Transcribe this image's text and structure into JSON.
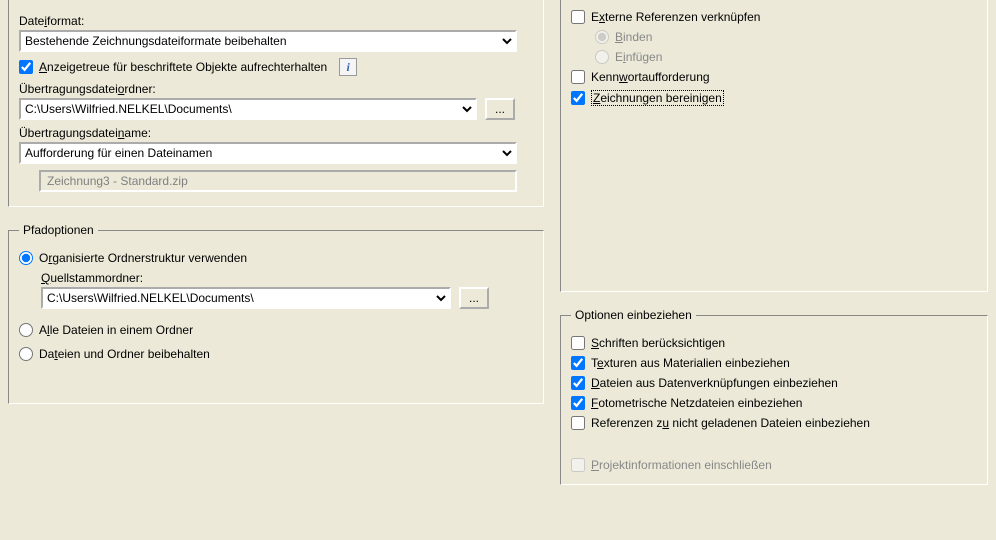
{
  "left_top": {
    "file_format_label_pre": "Date",
    "file_format_label_mn": "i",
    "file_format_label_post": "format:",
    "file_format_value": "Bestehende Zeichnungsdateiformate beibehalten",
    "visual_fidelity_pre": "",
    "visual_fidelity_mn": "A",
    "visual_fidelity_post": "nzeigetreue für beschriftete Objekte aufrechterhalten",
    "transfer_folder_label_pre": "Übertragungsdatei",
    "transfer_folder_label_mn": "o",
    "transfer_folder_label_post": "rdner:",
    "transfer_folder_value": "C:\\Users\\Wilfried.NELKEL\\Documents\\",
    "browse": "...",
    "transfer_name_label_pre": "Übertragungsdatei",
    "transfer_name_label_mn": "n",
    "transfer_name_label_post": "ame:",
    "transfer_name_value": "Aufforderung für einen Dateinamen",
    "filename_preview": "Zeichnung3 - Standard.zip"
  },
  "path_options": {
    "legend": "Pfadoptionen",
    "opt_org_pre": "O",
    "opt_org_mn": "r",
    "opt_org_post": "ganisierte Ordnerstruktur verwenden",
    "source_root_pre": "",
    "source_root_mn": "Q",
    "source_root_post": "uellstammordner:",
    "source_root_value": "C:\\Users\\Wilfried.NELKEL\\Documents\\",
    "browse": "...",
    "opt_all_pre": "A",
    "opt_all_mn": "l",
    "opt_all_post": "le Dateien in einem Ordner",
    "opt_keep_pre": "Da",
    "opt_keep_mn": "t",
    "opt_keep_post": "eien und Ordner beibehalten"
  },
  "right_top": {
    "ext_refs_pre": "E",
    "ext_refs_mn": "x",
    "ext_refs_post": "terne Referenzen verknüpfen",
    "bind_pre": "",
    "bind_mn": "B",
    "bind_post": "inden",
    "insert_pre": "E",
    "insert_mn": "i",
    "insert_post": "nfügen",
    "pwd_pre": "Kenn",
    "pwd_mn": "w",
    "pwd_post": "ortaufforderung",
    "purge_pre": "",
    "purge_mn": "Z",
    "purge_post": "eichnungen bereinigen"
  },
  "include_options": {
    "legend": "Optionen einbeziehen",
    "fonts_pre": "",
    "fonts_mn": "S",
    "fonts_post": "chriften berücksichtigen",
    "textures_pre": "T",
    "textures_mn": "e",
    "textures_post": "xturen aus Materialien einbeziehen",
    "datalinks_pre": "",
    "datalinks_mn": "D",
    "datalinks_post": "ateien aus Datenverknüpfungen einbeziehen",
    "photometric_pre": "",
    "photometric_mn": "F",
    "photometric_post": "otometrische Netzdateien einbeziehen",
    "unloaded_pre": "Referenzen z",
    "unloaded_mn": "u",
    "unloaded_post": " nicht geladenen Dateien einbeziehen",
    "project_pre": "",
    "project_mn": "P",
    "project_post": "rojektinformationen einschließen"
  }
}
